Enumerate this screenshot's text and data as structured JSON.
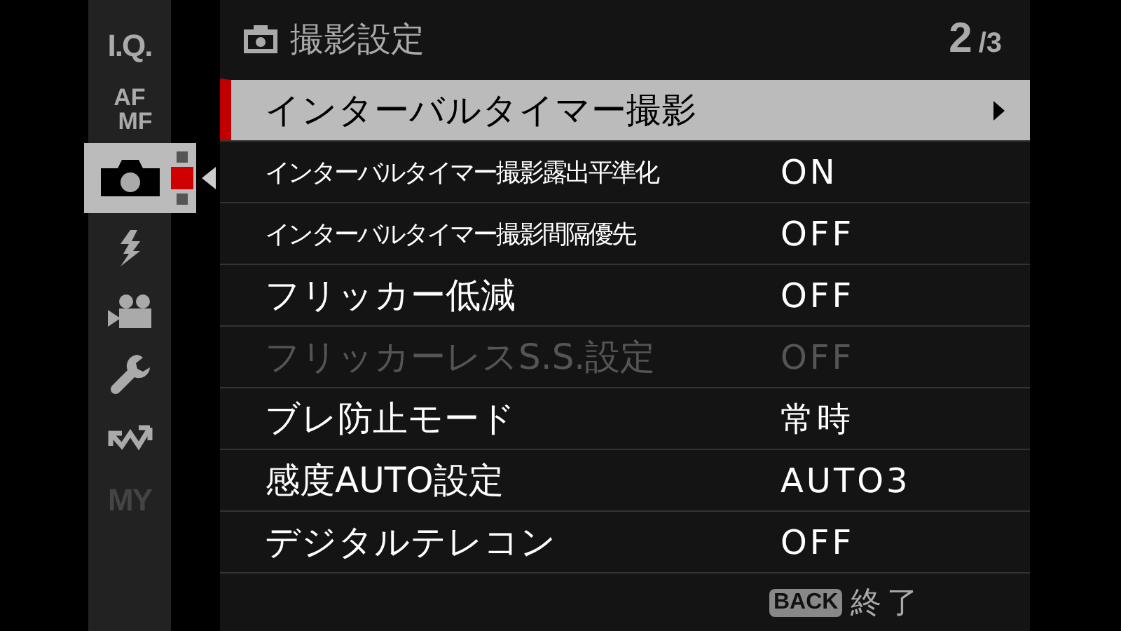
{
  "sidebar": {
    "items": [
      {
        "kind": "text",
        "label": "I.Q.",
        "selected": false,
        "disabled": false
      },
      {
        "kind": "stack",
        "label": "AF",
        "sublabel": "MF",
        "selected": false,
        "disabled": false
      },
      {
        "kind": "camera",
        "selected": true,
        "disabled": false,
        "pages": [
          {
            "selected": false
          },
          {
            "selected": true
          },
          {
            "selected": false
          }
        ]
      },
      {
        "kind": "flash",
        "selected": false,
        "disabled": false
      },
      {
        "kind": "movie",
        "selected": false,
        "disabled": false
      },
      {
        "kind": "wrench",
        "selected": false,
        "disabled": false
      },
      {
        "kind": "wireless",
        "selected": false,
        "disabled": false
      },
      {
        "kind": "text",
        "label": "MY",
        "selected": false,
        "disabled": true
      }
    ]
  },
  "header": {
    "title": "撮影設定",
    "page": "2",
    "total": "/3"
  },
  "rows": [
    {
      "label": "インターバルタイマー撮影",
      "selected": true,
      "disabled": false,
      "submenu": true
    },
    {
      "label": "インターバルタイマー撮影露出平準化",
      "value": "ON",
      "selected": false,
      "disabled": false,
      "submenu": false
    },
    {
      "label": "インターバルタイマー撮影間隔優先",
      "value": "OFF",
      "selected": false,
      "disabled": false,
      "submenu": false
    },
    {
      "label": "フリッカー低減",
      "value": "OFF",
      "selected": false,
      "disabled": false,
      "submenu": false
    },
    {
      "label": "フリッカーレスS.S.設定",
      "value": "OFF",
      "selected": false,
      "disabled": true,
      "submenu": false
    },
    {
      "label": "ブレ防止モード",
      "value": "常時",
      "selected": false,
      "disabled": false,
      "submenu": false
    },
    {
      "label": "感度AUTO設定",
      "value": "AUTO3",
      "selected": false,
      "disabled": false,
      "submenu": false
    },
    {
      "label": "デジタルテレコン",
      "value": "OFF",
      "selected": false,
      "disabled": false,
      "submenu": false
    }
  ],
  "footer": {
    "key": "BACK",
    "action": "終了"
  }
}
